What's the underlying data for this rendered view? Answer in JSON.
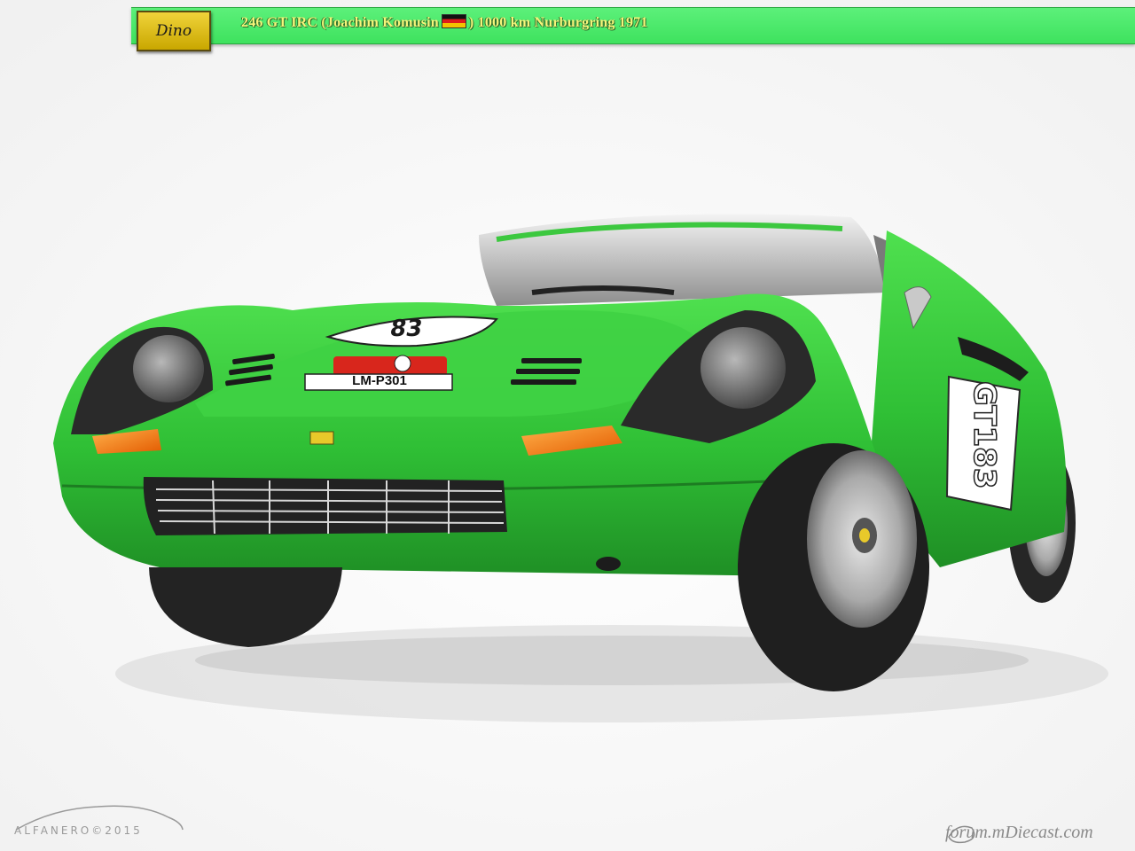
{
  "header": {
    "logo_text": "Dino",
    "title_before_flag": "246 GT  IRC (Joachim Komusin",
    "title_after_flag": ") 1000 km Nurburgring 1971",
    "bar_color": "#45e862",
    "text_color": "#f5f57a"
  },
  "car": {
    "body_color": "#33c83a",
    "hood_plate": "LM-P301",
    "door_number": "GT183",
    "hood_number": "83"
  },
  "watermarks": {
    "left_text": "ALFANERO©2015",
    "right_text": "forum.mDiecast.com"
  }
}
